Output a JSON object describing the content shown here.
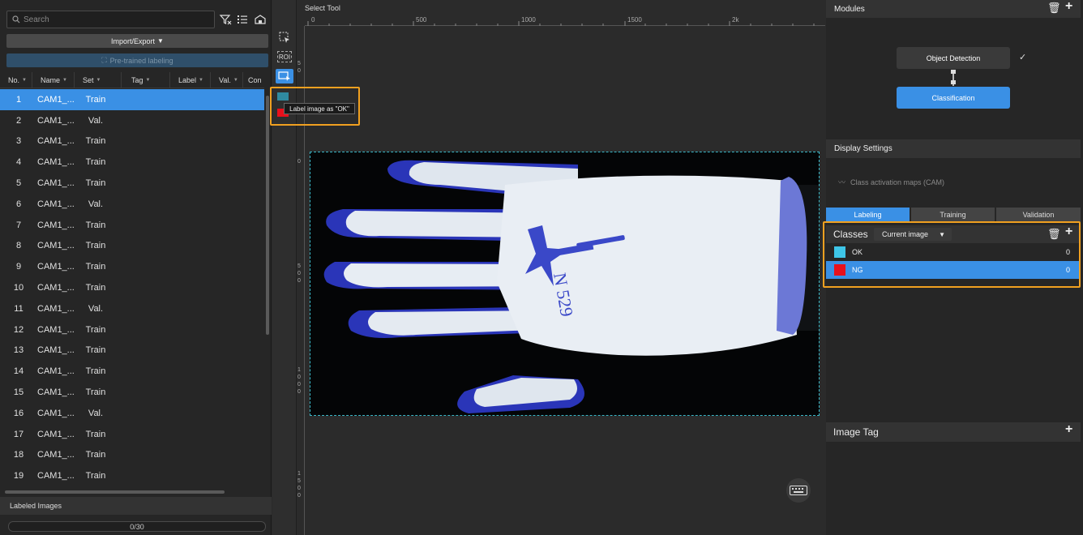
{
  "left_panel": {
    "search_placeholder": "Search",
    "import_export_label": "Import/Export",
    "pretrained_label": "Pre-trained labeling",
    "columns": [
      "No.",
      "Name",
      "Set",
      "Tag",
      "Label",
      "Val.",
      "Con"
    ],
    "rows": [
      {
        "no": "1",
        "name": "CAM1_...",
        "set": "Train"
      },
      {
        "no": "2",
        "name": "CAM1_...",
        "set": "Val."
      },
      {
        "no": "3",
        "name": "CAM1_...",
        "set": "Train"
      },
      {
        "no": "4",
        "name": "CAM1_...",
        "set": "Train"
      },
      {
        "no": "5",
        "name": "CAM1_...",
        "set": "Train"
      },
      {
        "no": "6",
        "name": "CAM1_...",
        "set": "Val."
      },
      {
        "no": "7",
        "name": "CAM1_...",
        "set": "Train"
      },
      {
        "no": "8",
        "name": "CAM1_...",
        "set": "Train"
      },
      {
        "no": "9",
        "name": "CAM1_...",
        "set": "Train"
      },
      {
        "no": "10",
        "name": "CAM1_...",
        "set": "Train"
      },
      {
        "no": "11",
        "name": "CAM1_...",
        "set": "Val."
      },
      {
        "no": "12",
        "name": "CAM1_...",
        "set": "Train"
      },
      {
        "no": "13",
        "name": "CAM1_...",
        "set": "Train"
      },
      {
        "no": "14",
        "name": "CAM1_...",
        "set": "Train"
      },
      {
        "no": "15",
        "name": "CAM1_...",
        "set": "Train"
      },
      {
        "no": "16",
        "name": "CAM1_...",
        "set": "Val."
      },
      {
        "no": "17",
        "name": "CAM1_...",
        "set": "Train"
      },
      {
        "no": "18",
        "name": "CAM1_...",
        "set": "Train"
      },
      {
        "no": "19",
        "name": "CAM1_...",
        "set": "Train"
      }
    ],
    "selected_row": 1,
    "labeled_images_label": "Labeled Images",
    "progress_text": "0/30"
  },
  "toolbar": {
    "roi_label": "ROI",
    "tooltip": "Label image as \"OK\""
  },
  "canvas": {
    "title": "Select Tool",
    "ruler_top_labels": [
      "0",
      "500",
      "1000",
      "1500",
      "2k"
    ],
    "ruler_left_labels": [
      "5\n0",
      "0",
      "5\n0\n0",
      "1\n0\n0\n0",
      "1\n5\n0\n0"
    ]
  },
  "right_panel": {
    "modules_title": "Modules",
    "module_object_detection": "Object Detection",
    "module_classification": "Classification",
    "display_settings_title": "Display Settings",
    "cam_label": "Class activation maps (CAM)",
    "tabs": [
      "Labeling",
      "Training",
      "Validation"
    ],
    "classes_title": "Classes",
    "classes_filter": "Current image",
    "classes": [
      {
        "name": "OK",
        "count": "0",
        "color": "#3ec6e8"
      },
      {
        "name": "NG",
        "count": "0",
        "color": "#e8101c"
      }
    ],
    "image_tag_title": "Image Tag"
  },
  "colors": {
    "accent": "#3a90e5",
    "highlight": "#f0a020",
    "ok": "#3ec6e8",
    "ng": "#e8101c"
  }
}
